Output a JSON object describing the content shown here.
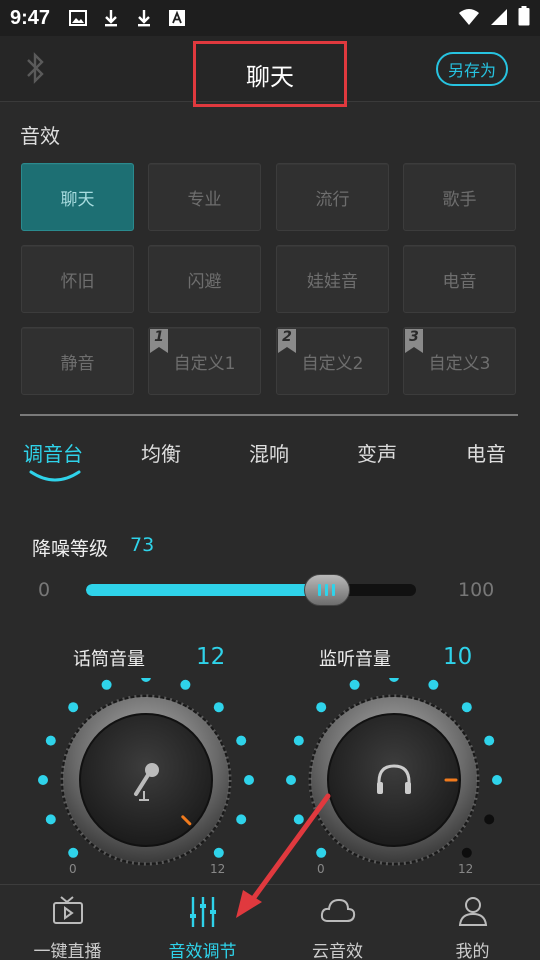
{
  "status_bar": {
    "time": "9:47"
  },
  "header": {
    "title": "聊天",
    "save_as": "另存为"
  },
  "sound_effects": {
    "section_label": "音效",
    "presets": [
      {
        "label": "聊天",
        "active": true
      },
      {
        "label": "专业"
      },
      {
        "label": "流行"
      },
      {
        "label": "歌手"
      },
      {
        "label": "怀旧"
      },
      {
        "label": "闪避"
      },
      {
        "label": "娃娃音"
      },
      {
        "label": "电音"
      },
      {
        "label": "静音"
      },
      {
        "label": "自定义1",
        "badge": "1"
      },
      {
        "label": "自定义2",
        "badge": "2"
      },
      {
        "label": "自定义3",
        "badge": "3"
      }
    ]
  },
  "tabs": [
    {
      "label": "调音台",
      "active": true
    },
    {
      "label": "均衡"
    },
    {
      "label": "混响"
    },
    {
      "label": "变声"
    },
    {
      "label": "电音"
    }
  ],
  "noise_reduction": {
    "label": "降噪等级",
    "value": 73,
    "min": "0",
    "max": "100"
  },
  "knobs": [
    {
      "label": "话筒音量",
      "value": 12,
      "min": "0",
      "max": "12",
      "icon": "microphone-icon"
    },
    {
      "label": "监听音量",
      "value": 10,
      "min": "0",
      "max": "12",
      "icon": "headphones-icon"
    }
  ],
  "bottom_nav": [
    {
      "label": "一键直播",
      "icon": "tv-play-icon"
    },
    {
      "label": "音效调节",
      "icon": "sliders-icon",
      "active": true
    },
    {
      "label": "云音效",
      "icon": "cloud-icon"
    },
    {
      "label": "我的",
      "icon": "user-icon"
    }
  ],
  "colors": {
    "accent": "#2fd3ea",
    "active_preset": "#1d6f73",
    "highlight_box": "#e0393e"
  }
}
